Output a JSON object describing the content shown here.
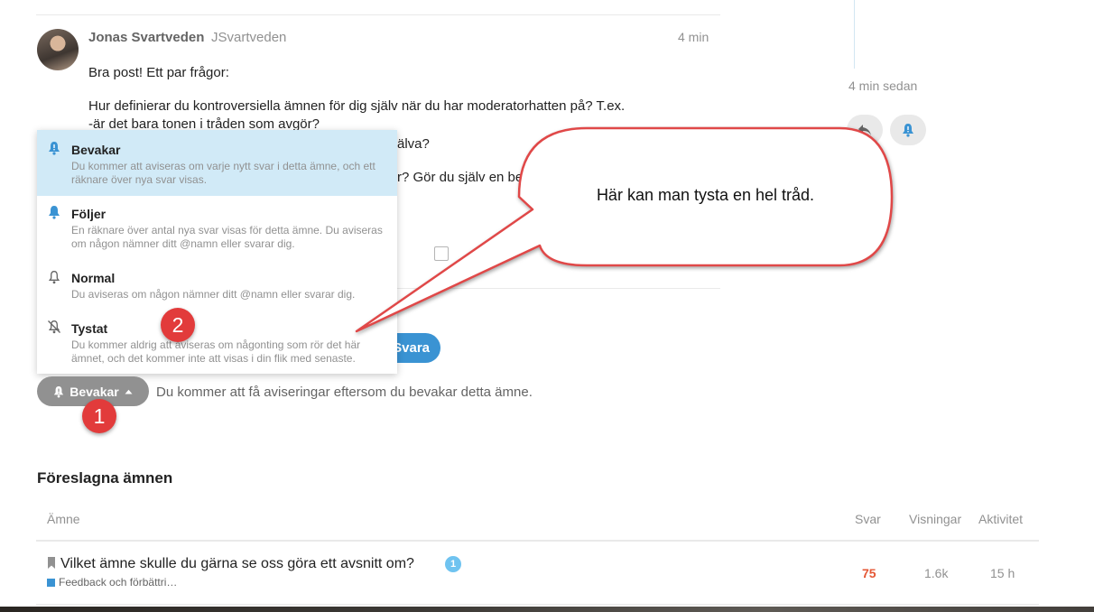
{
  "post": {
    "author_name": "Jonas Svartveden",
    "author_handle": "JSvartveden",
    "time": "4 min",
    "paragraph1": "Bra post! Ett par frågor:",
    "line2": "Hur definierar du kontroversiella ämnen för dig själv när du har moderatorhatten på? T.ex.",
    "line3": "-är det bara tonen i tråden som avgör?",
    "line4_tail": "älva?",
    "line5_tail": "r? Gör du själv en be"
  },
  "timeline": {
    "date": "4 min sedan"
  },
  "reply_button": {
    "label": "Svara"
  },
  "notification_menu": {
    "items": [
      {
        "title": "Bevakar",
        "desc": "Du kommer att aviseras om varje nytt svar i detta ämne, och ett räknare över nya svar visas.",
        "icon": "bell-exclamation-icon",
        "selected": true
      },
      {
        "title": "Följer",
        "desc": "En räknare över antal nya svar visas för detta ämne. Du aviseras om någon nämner ditt @namn eller svarar dig.",
        "icon": "bell-icon",
        "selected": false
      },
      {
        "title": "Normal",
        "desc": "Du aviseras om någon nämner ditt @namn eller svarar dig.",
        "icon": "bell-outline-icon",
        "selected": false
      },
      {
        "title": "Tystat",
        "desc": "Du kommer aldrig att aviseras om någonting som rör det här ämnet, och det kommer inte att visas i din flik med senaste.",
        "icon": "bell-slash-icon",
        "selected": false
      }
    ]
  },
  "notification_bar": {
    "button_label": "Bevakar",
    "reason": "Du kommer att få aviseringar eftersom du bevakar detta ämne."
  },
  "callout": {
    "text": "Här kan man tysta en hel tråd."
  },
  "markers": {
    "one": "1",
    "two": "2"
  },
  "suggested": {
    "title": "Föreslagna ämnen",
    "headers": {
      "topic": "Ämne",
      "replies": "Svar",
      "views": "Visningar",
      "activity": "Aktivitet"
    },
    "rows": [
      {
        "title": "Vilket ämne skulle du gärna se oss göra ett avsnitt om?",
        "unread": "1",
        "category": "Feedback och förbättri…",
        "replies": "75",
        "views": "1.6k",
        "activity": "15 h"
      }
    ]
  },
  "colors": {
    "accent": "#3a93d3",
    "marker": "#e23b3b",
    "hot_replies": "#e45735",
    "selected_bg": "#d1eaf7"
  }
}
